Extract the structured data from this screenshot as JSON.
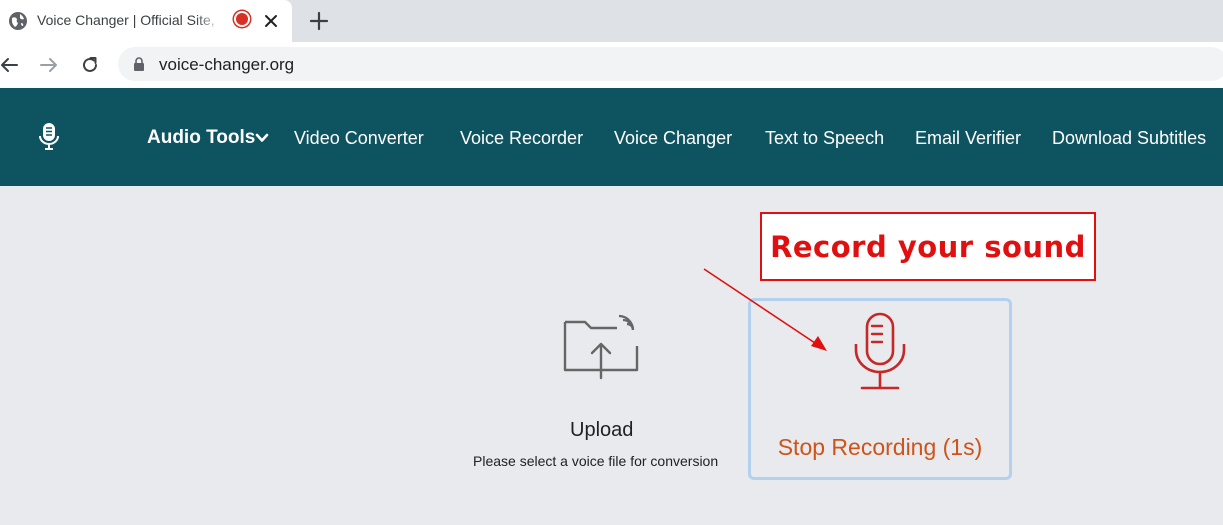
{
  "browser": {
    "tab": {
      "title": "Voice Changer | Official Site, ",
      "favicon": "globe-icon",
      "recording_indicator": "recording-dot-icon"
    },
    "url": "voice-changer.org"
  },
  "sitenav": {
    "logo": "microphone-icon",
    "items": [
      {
        "label": "Audio Tools",
        "has_dropdown": true
      },
      {
        "label": "Video Converter"
      },
      {
        "label": "Voice Recorder"
      },
      {
        "label": "Voice Changer"
      },
      {
        "label": "Text to Speech"
      },
      {
        "label": "Email Verifier"
      },
      {
        "label": "Download Subtitles"
      }
    ]
  },
  "main": {
    "upload": {
      "title": "Upload",
      "subtitle": "Please select a voice file for conversion",
      "icon": "folder-upload-icon"
    },
    "record": {
      "label": "Stop Recording (1s)",
      "icon": "microphone-icon"
    }
  },
  "annotation": {
    "text": "Record your sound"
  },
  "colors": {
    "nav_bg": "#0e5460",
    "record_accent": "#d0531a",
    "mic_red": "#c62828",
    "annotation_red": "#e01010",
    "record_border": "#b3d1ee"
  }
}
